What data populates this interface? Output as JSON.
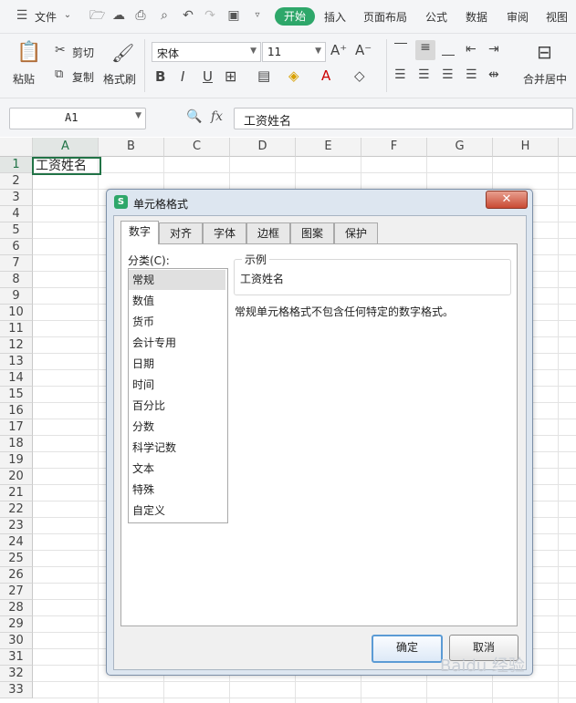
{
  "menu": {
    "file_label": "文件",
    "tabs": [
      "开始",
      "插入",
      "页面布局",
      "公式",
      "数据",
      "审阅",
      "视图"
    ]
  },
  "ribbon": {
    "paste_label": "粘贴",
    "cut_label": "剪切",
    "copy_label": "复制",
    "format_painter_label": "格式刷",
    "font_name": "宋体",
    "font_size": "11",
    "merge_center_label": "合并居中"
  },
  "formula_bar": {
    "name_box": "A1",
    "fx_label": "fx",
    "content": "工资姓名"
  },
  "sheet": {
    "columns": [
      "A",
      "B",
      "C",
      "D",
      "E",
      "F",
      "G",
      "H"
    ],
    "rows": [
      "1",
      "2",
      "3",
      "4",
      "5",
      "6",
      "7",
      "8",
      "9",
      "10",
      "11",
      "12",
      "13",
      "14",
      "15",
      "16",
      "17",
      "18",
      "19",
      "20",
      "21",
      "22",
      "23",
      "24",
      "25",
      "26",
      "27",
      "28",
      "29",
      "30",
      "31",
      "32",
      "33"
    ],
    "cell_a1": "工资姓名"
  },
  "dialog": {
    "title": "单元格格式",
    "tabs": [
      "数字",
      "对齐",
      "字体",
      "边框",
      "图案",
      "保护"
    ],
    "category_label": "分类(C):",
    "categories": [
      "常规",
      "数值",
      "货币",
      "会计专用",
      "日期",
      "时间",
      "百分比",
      "分数",
      "科学记数",
      "文本",
      "特殊",
      "自定义"
    ],
    "selected_category": "常规",
    "sample_label": "示例",
    "sample_value": "工资姓名",
    "description": "常规单元格格式不包含任何特定的数字格式。",
    "ok_label": "确定",
    "cancel_label": "取消"
  },
  "watermark": "Baidu 经验",
  "colors": {
    "accent": "#2ea76a",
    "selection_border": "#217346"
  }
}
